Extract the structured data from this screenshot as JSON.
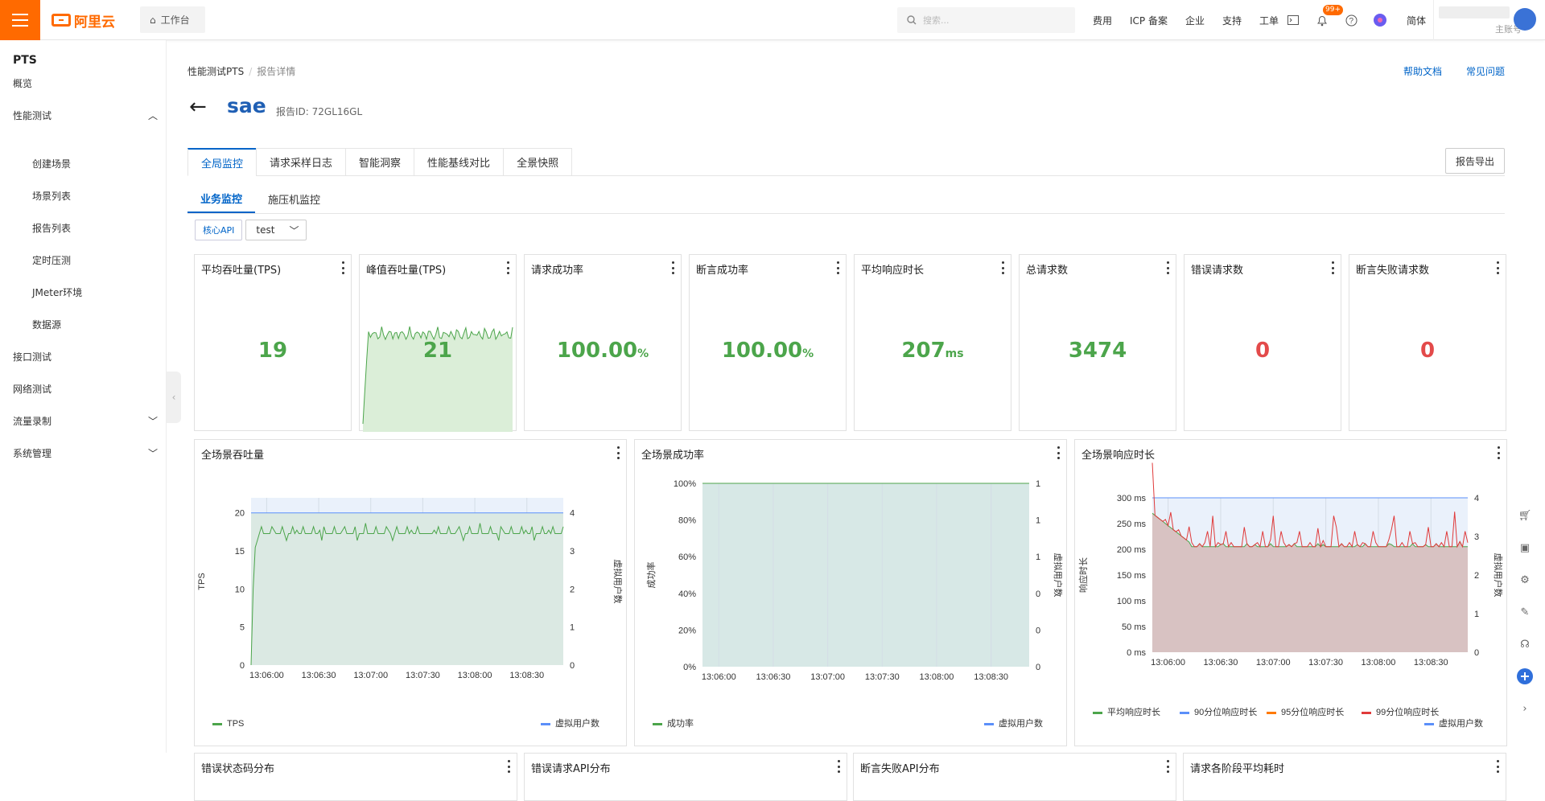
{
  "topbar": {
    "logo": "阿里云",
    "workbench": "工作台",
    "search_placeholder": "搜索...",
    "nav": [
      "费用",
      "ICP 备案",
      "企业",
      "支持",
      "工单"
    ],
    "badge": "99+",
    "lang": "简体",
    "account_sub": "主账号"
  },
  "sidebar": {
    "title": "PTS",
    "items": [
      {
        "label": "概览"
      },
      {
        "label": "性能测试"
      },
      {
        "label": "创建场景"
      },
      {
        "label": "场景列表"
      },
      {
        "label": "报告列表"
      },
      {
        "label": "定时压测"
      },
      {
        "label": "JMeter环境"
      },
      {
        "label": "数据源"
      },
      {
        "label": "接口测试"
      },
      {
        "label": "网络测试"
      },
      {
        "label": "流量录制"
      },
      {
        "label": "系统管理"
      }
    ]
  },
  "breadcrumb": {
    "root": "性能测试PTS",
    "current": "报告详情"
  },
  "help": {
    "doc": "帮助文档",
    "faq": "常见问题"
  },
  "header": {
    "title": "sae",
    "report_id_label": "报告ID:",
    "report_id": "72GL16GL"
  },
  "tabs": [
    "全局监控",
    "请求采样日志",
    "智能洞察",
    "性能基线对比",
    "全景快照"
  ],
  "export": "报告导出",
  "subtabs": [
    "业务监控",
    "施压机监控"
  ],
  "filter": {
    "api_button": "核心API",
    "select_value": "test"
  },
  "kpis": [
    {
      "title": "平均吞吐量(TPS)",
      "value": "19",
      "unit": ""
    },
    {
      "title": "峰值吞吐量(TPS)",
      "value": "21",
      "unit": ""
    },
    {
      "title": "请求成功率",
      "value": "100.00",
      "unit": "%"
    },
    {
      "title": "断言成功率",
      "value": "100.00",
      "unit": "%"
    },
    {
      "title": "平均响应时长",
      "value": "207",
      "unit": "ms"
    },
    {
      "title": "总请求数",
      "value": "3474",
      "unit": ""
    },
    {
      "title": "错误请求数",
      "value": "0",
      "unit": ""
    },
    {
      "title": "断言失败请求数",
      "value": "0",
      "unit": ""
    }
  ],
  "bottom_cards": [
    "错误状态码分布",
    "错误请求API分布",
    "断言失败API分布",
    "请求各阶段平均耗时"
  ],
  "chart_data": [
    {
      "type": "line",
      "title": "全场景吞吐量",
      "ylabel": "TPS",
      "y2label": "虚拟用户数",
      "x": [
        "13:06:00",
        "13:06:30",
        "13:07:00",
        "13:07:30",
        "13:08:00",
        "13:08:30"
      ],
      "ylim": [
        0,
        22
      ],
      "yticks": [
        "0",
        "5",
        "10",
        "15",
        "20"
      ],
      "y2ticks": [
        "0",
        "1",
        "2",
        "3",
        "4"
      ],
      "series": [
        {
          "name": "TPS",
          "color": "#4ca54b"
        },
        {
          "name": "虚拟用户数",
          "color": "#5b8ff9",
          "value": 4
        }
      ]
    },
    {
      "type": "area",
      "title": "全场景成功率",
      "ylabel": "成功率",
      "y2label": "虚拟用户数",
      "x": [
        "13:06:00",
        "13:06:30",
        "13:07:00",
        "13:07:30",
        "13:08:00",
        "13:08:30"
      ],
      "yticks": [
        "0%",
        "20%",
        "40%",
        "60%",
        "80%",
        "100%"
      ],
      "y2ticks": [
        "0",
        "0",
        "0",
        "1",
        "1",
        "1"
      ],
      "series": [
        {
          "name": "成功率",
          "color": "#4ca54b",
          "value": 100
        },
        {
          "name": "虚拟用户数",
          "color": "#5b8ff9"
        }
      ]
    },
    {
      "type": "line",
      "title": "全场景响应时长",
      "ylabel": "响应时长",
      "y2label": "虚拟用户数",
      "x": [
        "13:06:00",
        "13:06:30",
        "13:07:00",
        "13:07:30",
        "13:08:00",
        "13:08:30"
      ],
      "yticks": [
        "0 ms",
        "50 ms",
        "100 ms",
        "150 ms",
        "200 ms",
        "250 ms",
        "300 ms"
      ],
      "y2ticks": [
        "0",
        "1",
        "2",
        "3",
        "4"
      ],
      "series": [
        {
          "name": "平均响应时长",
          "color": "#4ca54b"
        },
        {
          "name": "90分位响应时长",
          "color": "#5b8ff9"
        },
        {
          "name": "95分位响应时长",
          "color": "#ff7a00"
        },
        {
          "name": "99分位响应时长",
          "color": "#e03a3a"
        },
        {
          "name": "虚拟用户数",
          "color": "#5b8ff9"
        }
      ]
    }
  ]
}
